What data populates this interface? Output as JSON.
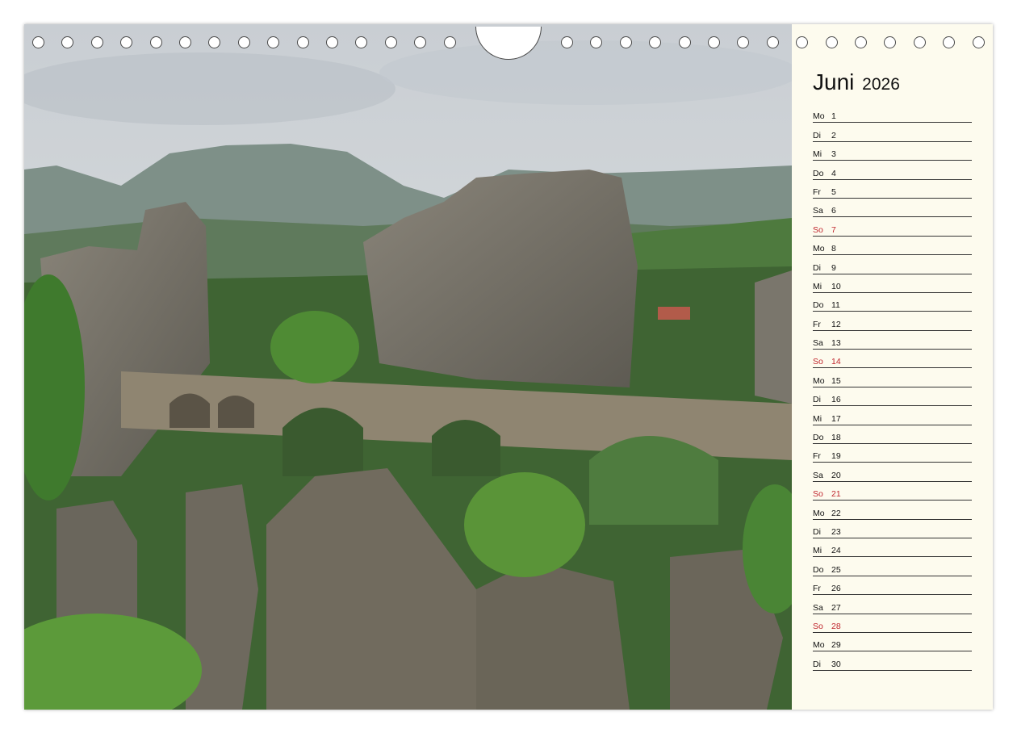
{
  "calendar": {
    "month": "Juni",
    "year": "2026",
    "days": [
      {
        "weekday": "Mo",
        "day": "1",
        "sunday": false
      },
      {
        "weekday": "Di",
        "day": "2",
        "sunday": false
      },
      {
        "weekday": "Mi",
        "day": "3",
        "sunday": false
      },
      {
        "weekday": "Do",
        "day": "4",
        "sunday": false
      },
      {
        "weekday": "Fr",
        "day": "5",
        "sunday": false
      },
      {
        "weekday": "Sa",
        "day": "6",
        "sunday": false
      },
      {
        "weekday": "So",
        "day": "7",
        "sunday": true
      },
      {
        "weekday": "Mo",
        "day": "8",
        "sunday": false
      },
      {
        "weekday": "Di",
        "day": "9",
        "sunday": false
      },
      {
        "weekday": "Mi",
        "day": "10",
        "sunday": false
      },
      {
        "weekday": "Do",
        "day": "11",
        "sunday": false
      },
      {
        "weekday": "Fr",
        "day": "12",
        "sunday": false
      },
      {
        "weekday": "Sa",
        "day": "13",
        "sunday": false
      },
      {
        "weekday": "So",
        "day": "14",
        "sunday": true
      },
      {
        "weekday": "Mo",
        "day": "15",
        "sunday": false
      },
      {
        "weekday": "Di",
        "day": "16",
        "sunday": false
      },
      {
        "weekday": "Mi",
        "day": "17",
        "sunday": false
      },
      {
        "weekday": "Do",
        "day": "18",
        "sunday": false
      },
      {
        "weekday": "Fr",
        "day": "19",
        "sunday": false
      },
      {
        "weekday": "Sa",
        "day": "20",
        "sunday": false
      },
      {
        "weekday": "So",
        "day": "21",
        "sunday": true
      },
      {
        "weekday": "Mo",
        "day": "22",
        "sunday": false
      },
      {
        "weekday": "Di",
        "day": "23",
        "sunday": false
      },
      {
        "weekday": "Mi",
        "day": "24",
        "sunday": false
      },
      {
        "weekday": "Do",
        "day": "25",
        "sunday": false
      },
      {
        "weekday": "Fr",
        "day": "26",
        "sunday": false
      },
      {
        "weekday": "Sa",
        "day": "27",
        "sunday": false
      },
      {
        "weekday": "So",
        "day": "28",
        "sunday": true
      },
      {
        "weekday": "Mo",
        "day": "29",
        "sunday": false
      },
      {
        "weekday": "Di",
        "day": "30",
        "sunday": false
      }
    ]
  },
  "colors": {
    "sunday": "#c0262e",
    "panel": "#fdfbee",
    "rule": "#333333"
  }
}
